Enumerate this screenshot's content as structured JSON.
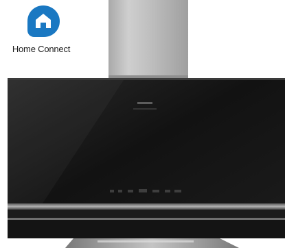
{
  "brand": {
    "name": "Home Connect",
    "icon": "home-connect-icon",
    "icon_color": "#1a78c2"
  },
  "product": {
    "type": "wall-mounted chimney cooker hood",
    "glass_color": "#151515",
    "chimney_color": "#b9b9b9",
    "trim_color": "#8a8a8a"
  }
}
